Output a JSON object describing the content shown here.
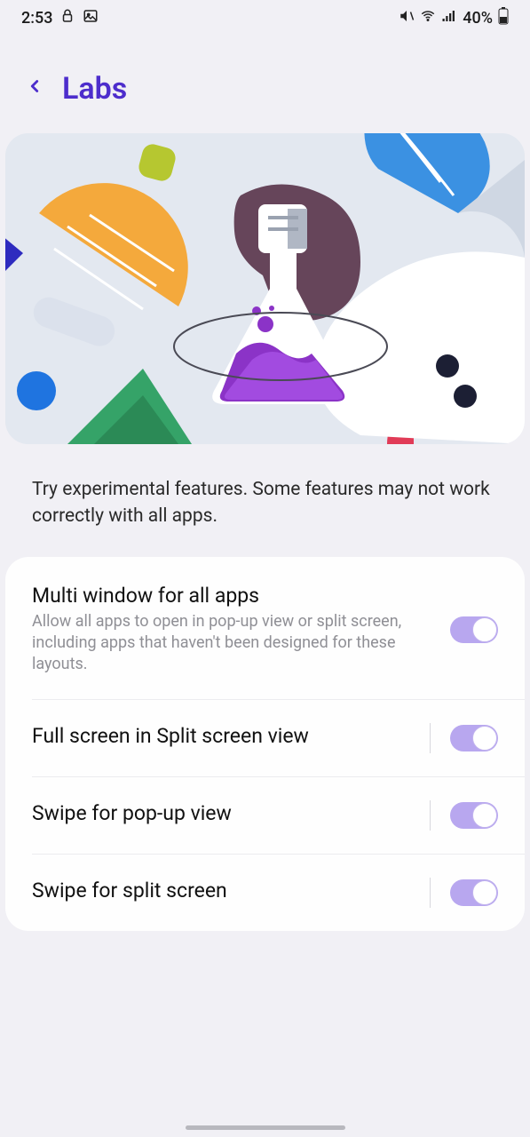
{
  "status": {
    "time": "2:53",
    "battery_pct": "40%"
  },
  "header": {
    "title": "Labs"
  },
  "intro": "Try experimental features. Some features may not work correctly with all apps.",
  "settings": [
    {
      "title": "Multi window for all apps",
      "desc": "Allow all apps to open in pop-up view or split screen, including apps that haven't been designed for these layouts.",
      "on": true
    },
    {
      "title": "Full screen in Split screen view",
      "desc": "",
      "on": true
    },
    {
      "title": "Swipe for pop-up view",
      "desc": "",
      "on": true
    },
    {
      "title": "Swipe for split screen",
      "desc": "",
      "on": true
    }
  ]
}
